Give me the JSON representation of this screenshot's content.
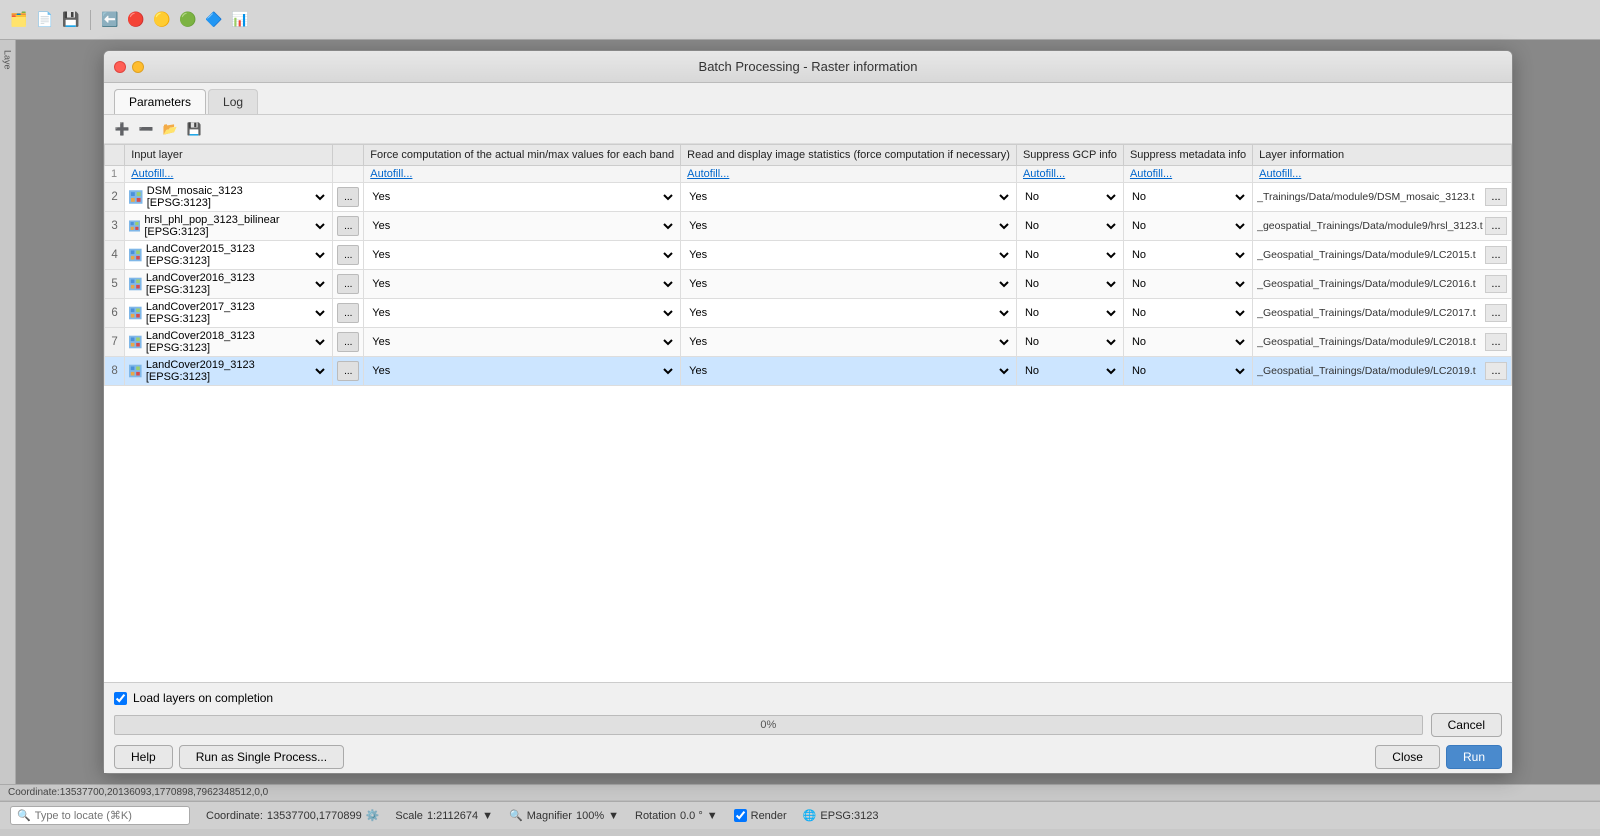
{
  "window": {
    "title": "Batch Processing - Raster information",
    "close_label": "×",
    "minimize_label": "−"
  },
  "tabs": [
    {
      "id": "parameters",
      "label": "Parameters",
      "active": true
    },
    {
      "id": "log",
      "label": "Log",
      "active": false
    }
  ],
  "toolbar": {
    "icons": [
      {
        "name": "add-row-icon",
        "glyph": "➕"
      },
      {
        "name": "remove-row-icon",
        "glyph": "➖"
      },
      {
        "name": "open-icon",
        "glyph": "📂"
      },
      {
        "name": "save-icon",
        "glyph": "💾"
      }
    ]
  },
  "table": {
    "columns": [
      {
        "id": "row-num",
        "label": ""
      },
      {
        "id": "input-layer",
        "label": "Input layer"
      },
      {
        "id": "browse",
        "label": ""
      },
      {
        "id": "force-compute",
        "label": "Force computation of the actual min/max values for each band"
      },
      {
        "id": "read-display",
        "label": "Read and display image statistics (force computation if necessary)"
      },
      {
        "id": "suppress-gcp",
        "label": "Suppress GCP info"
      },
      {
        "id": "suppress-meta",
        "label": "Suppress metadata info"
      },
      {
        "id": "layer-info",
        "label": "Layer information"
      }
    ],
    "autofill": {
      "label": "Autofill...",
      "cells": [
        "Autofill...",
        "Autofill...",
        "Autofill...",
        "Autofill...",
        "Autofill...",
        "Autofill..."
      ]
    },
    "rows": [
      {
        "num": "2",
        "layer": "DSM_mosaic_3123 [EPSG:3123]",
        "has_icon": true,
        "force_compute": "Yes",
        "read_display": "Yes",
        "suppress_gcp": "No",
        "suppress_meta": "No",
        "layer_info_path": "_Trainings/Data/module9/DSM_mosaic_3123.t",
        "selected": false
      },
      {
        "num": "3",
        "layer": "hrsl_phl_pop_3123_bilinear [EPSG:3123]",
        "has_icon": true,
        "force_compute": "Yes",
        "read_display": "Yes",
        "suppress_gcp": "No",
        "suppress_meta": "No",
        "layer_info_path": "_geospatial_Trainings/Data/module9/hrsl_3123.t",
        "selected": false
      },
      {
        "num": "4",
        "layer": "LandCover2015_3123 [EPSG:3123]",
        "has_icon": true,
        "force_compute": "Yes",
        "read_display": "Yes",
        "suppress_gcp": "No",
        "suppress_meta": "No",
        "layer_info_path": "_Geospatial_Trainings/Data/module9/LC2015.t",
        "selected": false
      },
      {
        "num": "5",
        "layer": "LandCover2016_3123 [EPSG:3123]",
        "has_icon": true,
        "force_compute": "Yes",
        "read_display": "Yes",
        "suppress_gcp": "No",
        "suppress_meta": "No",
        "layer_info_path": "_Geospatial_Trainings/Data/module9/LC2016.t",
        "selected": false
      },
      {
        "num": "6",
        "layer": "LandCover2017_3123 [EPSG:3123]",
        "has_icon": true,
        "force_compute": "Yes",
        "read_display": "Yes",
        "suppress_gcp": "No",
        "suppress_meta": "No",
        "layer_info_path": "_Geospatial_Trainings/Data/module9/LC2017.t",
        "selected": false
      },
      {
        "num": "7",
        "layer": "LandCover2018_3123 [EPSG:3123]",
        "has_icon": true,
        "force_compute": "Yes",
        "read_display": "Yes",
        "suppress_gcp": "No",
        "suppress_meta": "No",
        "layer_info_path": "_Geospatial_Trainings/Data/module9/LC2018.t",
        "selected": false
      },
      {
        "num": "8",
        "layer": "LandCover2019_3123 [EPSG:3123]",
        "has_icon": true,
        "force_compute": "Yes",
        "read_display": "Yes",
        "suppress_gcp": "No",
        "suppress_meta": "No",
        "layer_info_path": "_Geospatial_Trainings/Data/module9/LC2019.t",
        "selected": true
      }
    ],
    "yes_options": [
      "Yes",
      "No"
    ],
    "no_options": [
      "No",
      "Yes"
    ]
  },
  "footer": {
    "load_layers_label": "Load layers on completion",
    "load_layers_checked": true,
    "progress_percent": "0%",
    "progress_value": 0,
    "cancel_label": "Cancel"
  },
  "buttons": {
    "help_label": "Help",
    "run_as_single_label": "Run as Single Process...",
    "close_label": "Close",
    "run_label": "Run"
  },
  "status_bar": {
    "coordinate_label": "Coordinate:",
    "coordinate_value": "13537700,1770899",
    "scale_label": "Scale",
    "scale_value": "1:2112674",
    "magnifier_label": "Magnifier",
    "magnifier_value": "100%",
    "rotation_label": "Rotation",
    "rotation_value": "0.0 °",
    "render_label": "Render",
    "epsg_label": "EPSG:3123",
    "bottom_coordinate": "Coordinate:13537700,20136093,1770898,7962348512,0,0",
    "search_placeholder": "Type to locate (⌘K)"
  }
}
